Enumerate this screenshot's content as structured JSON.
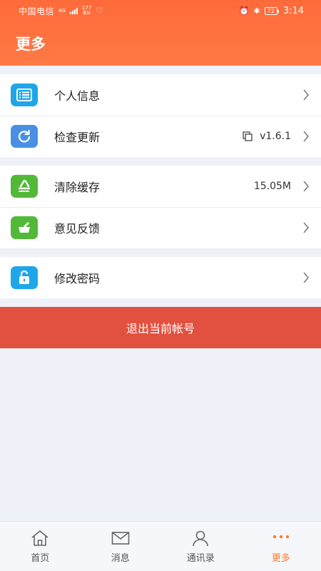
{
  "status_bar": {
    "carrier": "中国电信",
    "network": "4G",
    "speed_value": "177",
    "speed_unit": "B/s",
    "battery": "72",
    "time": "3:14"
  },
  "header": {
    "title": "更多"
  },
  "groups": [
    {
      "items": [
        {
          "label": "个人信息",
          "value": "",
          "icon": "profile-list-icon",
          "color": "#1fa6e9"
        },
        {
          "label": "检查更新",
          "value": "v1.6.1",
          "icon": "refresh-icon",
          "color": "#4a90e2"
        }
      ]
    },
    {
      "items": [
        {
          "label": "清除缓存",
          "value": "15.05M",
          "icon": "recycle-icon",
          "color": "#52b838"
        },
        {
          "label": "意见反馈",
          "value": "",
          "icon": "feedback-icon",
          "color": "#52b838"
        }
      ]
    },
    {
      "items": [
        {
          "label": "修改密码",
          "value": "",
          "icon": "lock-icon",
          "color": "#1fa6e9"
        }
      ]
    }
  ],
  "logout": {
    "label": "退出当前帐号",
    "color": "#e2513f"
  },
  "tabbar": {
    "items": [
      {
        "label": "首页",
        "icon": "home-icon"
      },
      {
        "label": "消息",
        "icon": "mail-icon"
      },
      {
        "label": "通讯录",
        "icon": "contacts-icon"
      },
      {
        "label": "更多",
        "icon": "more-dots-icon",
        "active": true
      }
    ],
    "active_color": "#ff7a2e"
  }
}
